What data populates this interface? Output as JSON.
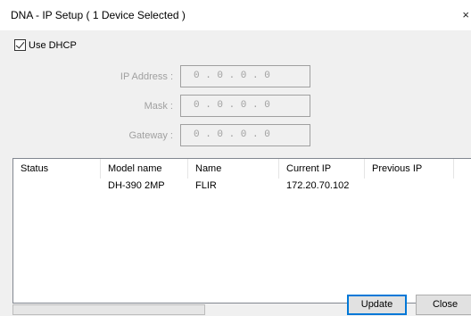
{
  "window": {
    "title": "DNA - IP Setup ( 1 Device Selected )",
    "close_glyph": "×"
  },
  "dhcp": {
    "label": "Use DHCP",
    "checked": true
  },
  "fields": {
    "ip_label": "IP Address :",
    "ip_value": "0 . 0 . 0 . 0",
    "mask_label": "Mask :",
    "mask_value": "0 . 0 . 0 . 0",
    "gateway_label": "Gateway :",
    "gateway_value": "0 . 0 . 0 . 0"
  },
  "table": {
    "columns": [
      "Status",
      "Model name",
      "Name",
      "Current IP",
      "Previous IP"
    ],
    "rows": [
      {
        "status": "",
        "model": "DH-390 2MP",
        "name": "FLIR",
        "current_ip": "172.20.70.102",
        "previous_ip": ""
      }
    ]
  },
  "progress": {
    "value": 0
  },
  "buttons": {
    "update": "Update",
    "close": "Close"
  },
  "colors": {
    "accent": "#0078d7",
    "window_bg": "#f0f0f0",
    "disabled_text": "#a0a0a0"
  }
}
